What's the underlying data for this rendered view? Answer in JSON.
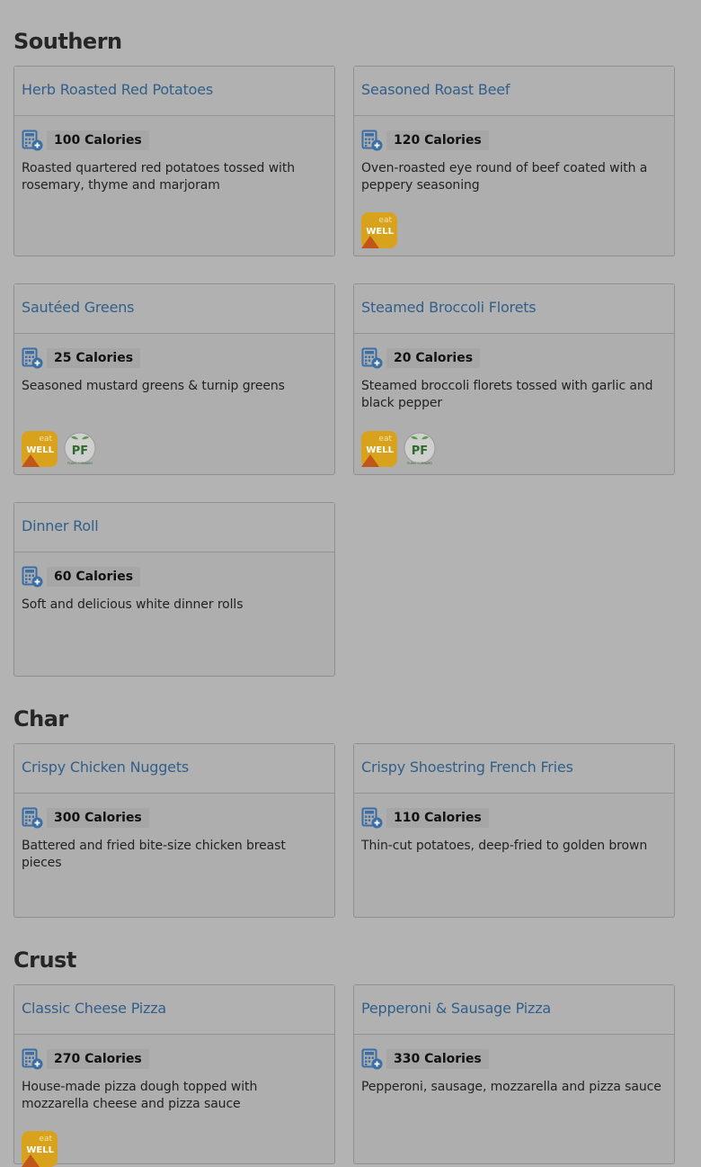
{
  "sections": {
    "southern": {
      "title": "Southern",
      "items": [
        {
          "name": "Herb Roasted Red Potatoes",
          "calories": "100 Calories",
          "description": "Roasted quartered red potatoes tossed with rosemary, thyme and marjoram"
        },
        {
          "name": "Seasoned Roast Beef",
          "calories": "120 Calories",
          "description": "Oven-roasted eye round of beef coated with a peppery seasoning"
        },
        {
          "name": "Sautéed Greens",
          "calories": "25 Calories",
          "description": "Seasoned mustard greens & turnip greens"
        },
        {
          "name": "Steamed Broccoli Florets",
          "calories": "20 Calories",
          "description": "Steamed broccoli florets tossed with garlic and black pepper"
        },
        {
          "name": "Dinner Roll",
          "calories": "60 Calories",
          "description": "Soft and delicious white dinner rolls"
        }
      ]
    },
    "char": {
      "title": "Char",
      "items": [
        {
          "name": "Crispy Chicken Nuggets",
          "calories": "300 Calories",
          "description": "Battered and fried bite-size chicken breast pieces"
        },
        {
          "name": "Crispy Shoestring French Fries",
          "calories": "110 Calories",
          "description": "Thin-cut potatoes, deep-fried to golden brown"
        }
      ]
    },
    "crust": {
      "title": "Crust",
      "items": [
        {
          "name": "Classic Cheese Pizza",
          "calories": "270 Calories",
          "description": "House-made pizza dough topped with mozzarella cheese and pizza sauce"
        },
        {
          "name": "Pepperoni & Sausage Pizza",
          "calories": "330 Calories",
          "description": "Pepperoni, sausage, mozzarella and pizza sauce"
        }
      ]
    }
  },
  "badges": {
    "eat_well": {
      "line1": "eat",
      "line2": "WELL",
      "color": "#d9a21c"
    },
    "plant_forward": {
      "text": "PF",
      "small": "PLANT FORWARD",
      "color": "#3a7a3a"
    }
  },
  "colors": {
    "title_link": "#315f8a",
    "calculator_icon": "#3a6ea5"
  }
}
